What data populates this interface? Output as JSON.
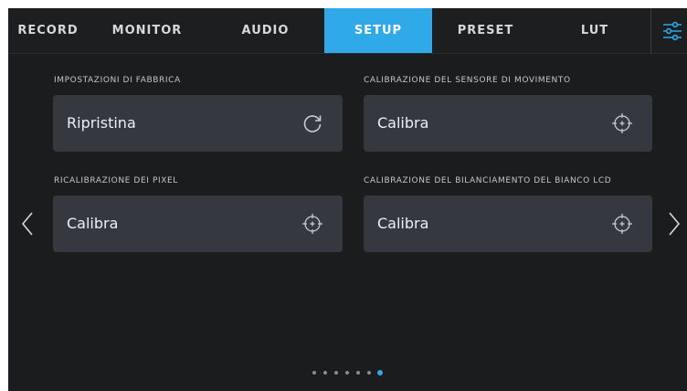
{
  "tabs": [
    {
      "label": "RECORD",
      "active": false
    },
    {
      "label": "MONITOR",
      "active": false
    },
    {
      "label": "AUDIO",
      "active": false
    },
    {
      "label": "SETUP",
      "active": true
    },
    {
      "label": "PRESET",
      "active": false
    },
    {
      "label": "LUT",
      "active": false
    }
  ],
  "settings_icon": "sliders-icon",
  "accent_color": "#2fa9e8",
  "sections": {
    "factory_reset": {
      "title": "IMPOSTAZIONI DI FABBRICA",
      "button": "Ripristina",
      "icon": "reset-icon"
    },
    "motion_calibration": {
      "title": "CALIBRAZIONE DEL SENSORE DI MOVIMENTO",
      "button": "Calibra",
      "icon": "crosshair-icon"
    },
    "pixel_recalibration": {
      "title": "RICALIBRAZIONE DEI PIXEL",
      "button": "Calibra",
      "icon": "crosshair-icon"
    },
    "lcd_white_balance": {
      "title": "CALIBRAZIONE DEL BILANCIAMENTO DEL BIANCO LCD",
      "button": "Calibra",
      "icon": "crosshair-icon"
    }
  },
  "pagination": {
    "pages": 7,
    "current": 7
  }
}
